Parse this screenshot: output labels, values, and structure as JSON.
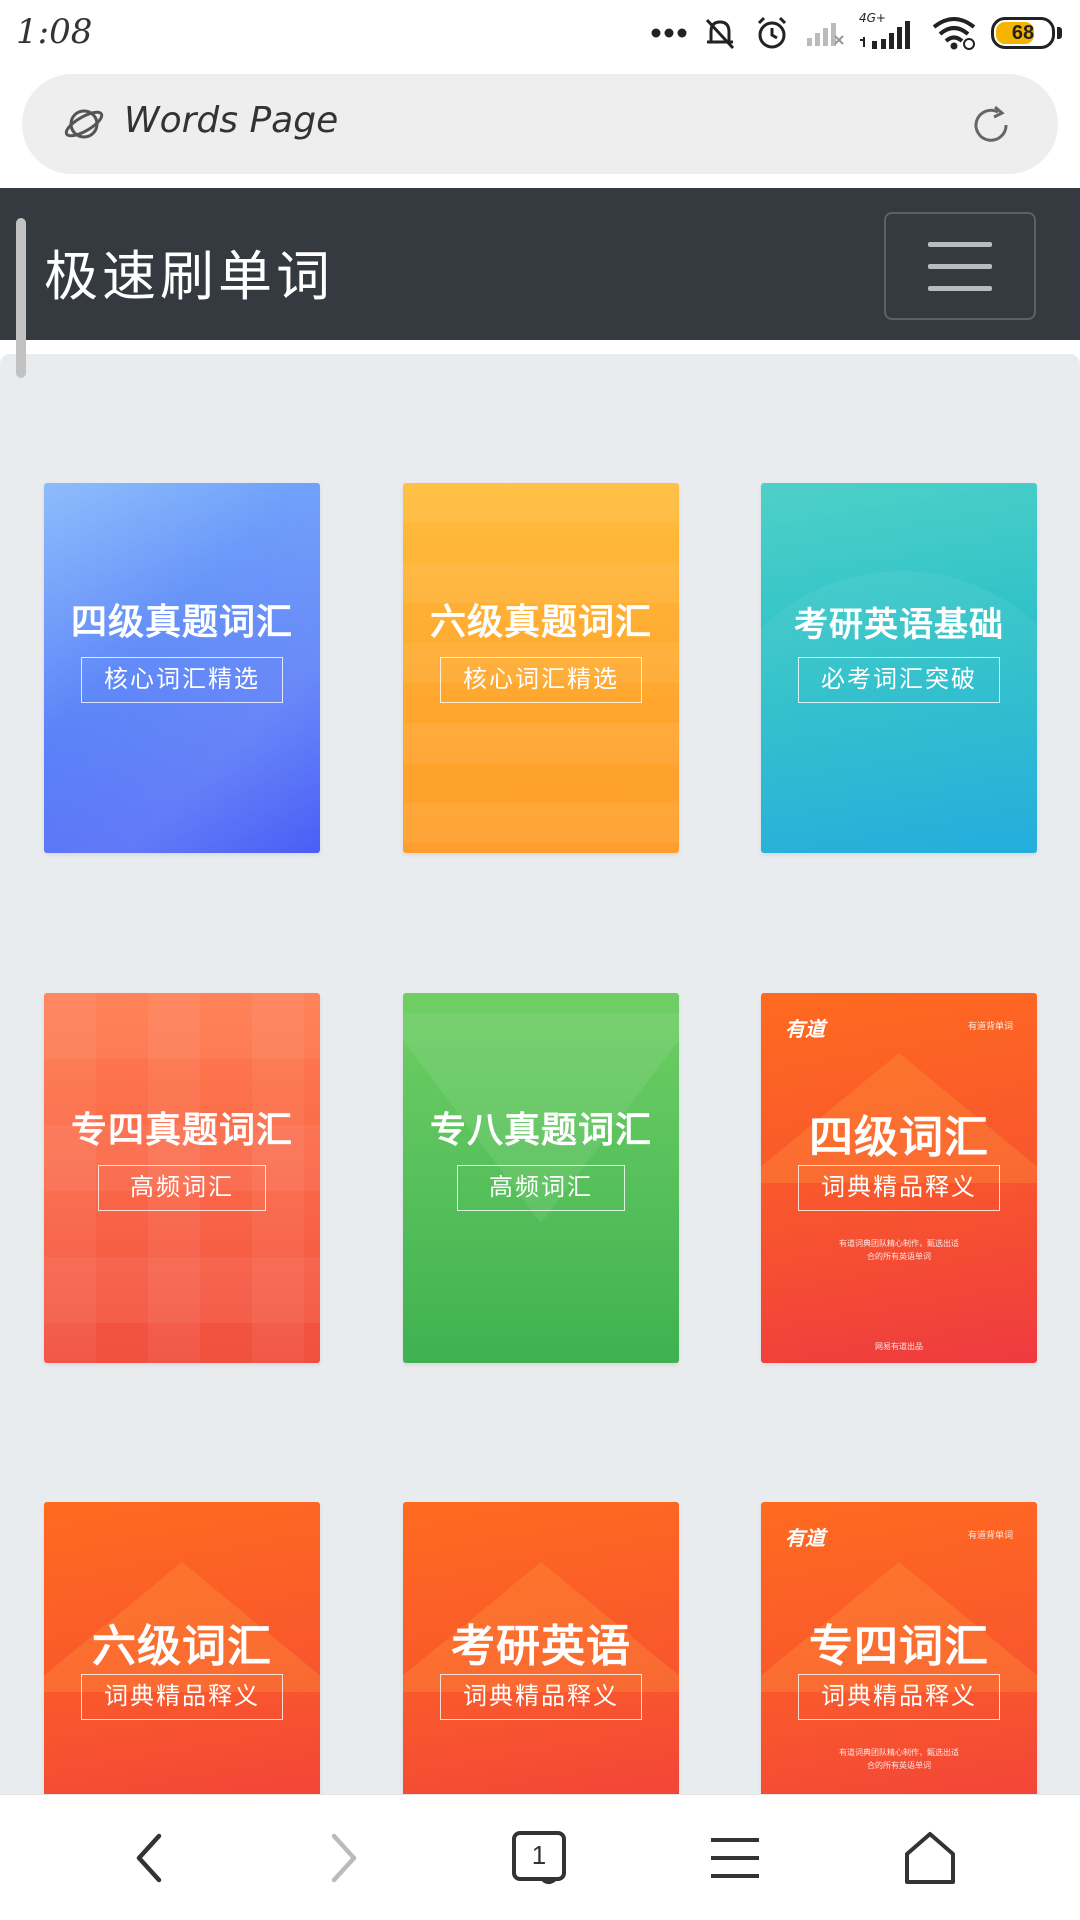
{
  "status_bar": {
    "time": "1:08",
    "network_label": "4G+",
    "battery_level": "68"
  },
  "browser": {
    "address_text": "Words Page"
  },
  "site": {
    "brand": "极速刷单词"
  },
  "books": [
    {
      "title": "四级真题词汇",
      "subtitle": "核心词汇精选"
    },
    {
      "title": "六级真题词汇",
      "subtitle": "核心词汇精选"
    },
    {
      "title": "考研英语基础",
      "subtitle": "必考词汇突破"
    },
    {
      "title": "专四真题词汇",
      "subtitle": "高频词汇"
    },
    {
      "title": "专八真题词汇",
      "subtitle": "高频词汇"
    },
    {
      "title": "四级词汇",
      "subtitle": "词典精品释义",
      "logo": "有道",
      "tag": "有道背单词",
      "desc_line1": "有道词典团队精心制作，甄选出适",
      "desc_line2": "合的所有英语单词",
      "publisher": "网易有道出品"
    },
    {
      "title": "六级词汇",
      "subtitle": "词典精品释义"
    },
    {
      "title": "考研英语",
      "subtitle": "词典精品释义"
    },
    {
      "title": "专四词汇",
      "subtitle": "词典精品释义",
      "logo": "有道",
      "tag": "有道背单词",
      "desc_line1": "有道词典团队精心制作，甄选出适",
      "desc_line2": "合的所有英语单词"
    }
  ],
  "bottom_nav": {
    "tab_count": "1",
    "icons": [
      "back-icon",
      "forward-icon",
      "tabs-icon",
      "menu-icon",
      "home-icon"
    ]
  }
}
